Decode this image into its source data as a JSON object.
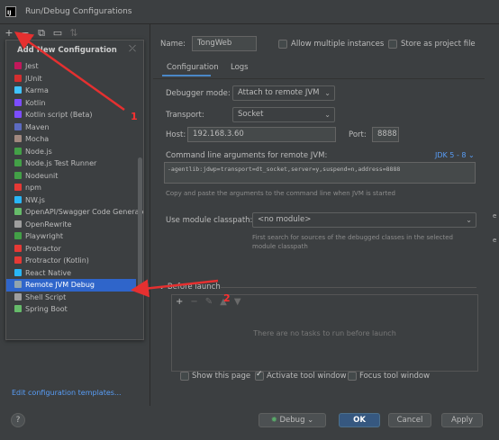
{
  "window": {
    "title": "Run/Debug Configurations",
    "app_icon_letters": "IJ"
  },
  "toolbar": {
    "icons": [
      "add-icon",
      "remove-icon",
      "copy-icon",
      "folder-icon",
      "sort-icon"
    ]
  },
  "popup": {
    "title": "Add New Configuration",
    "items": [
      {
        "label": "Jest",
        "color": "#c2185b"
      },
      {
        "label": "JUnit",
        "color": "#d32f2f"
      },
      {
        "label": "Karma",
        "color": "#40c4ff"
      },
      {
        "label": "Kotlin",
        "color": "#7c4dff"
      },
      {
        "label": "Kotlin script (Beta)",
        "color": "#7c4dff"
      },
      {
        "label": "Maven",
        "color": "#5c6bc0"
      },
      {
        "label": "Mocha",
        "color": "#a1887f"
      },
      {
        "label": "Node.js",
        "color": "#43a047"
      },
      {
        "label": "Node.js Test Runner",
        "color": "#43a047"
      },
      {
        "label": "Nodeunit",
        "color": "#43a047"
      },
      {
        "label": "npm",
        "color": "#e53935"
      },
      {
        "label": "NW.js",
        "color": "#29b6f6"
      },
      {
        "label": "OpenAPI/Swagger Code Generator",
        "color": "#66bb6a"
      },
      {
        "label": "OpenRewrite",
        "color": "#9e9e9e"
      },
      {
        "label": "Playwright",
        "color": "#43a047"
      },
      {
        "label": "Protractor",
        "color": "#e53935"
      },
      {
        "label": "Protractor (Kotlin)",
        "color": "#e53935"
      },
      {
        "label": "React Native",
        "color": "#29b6f6"
      },
      {
        "label": "Remote JVM Debug",
        "color": "#90a4ae"
      },
      {
        "label": "Shell Script",
        "color": "#9e9e9e"
      },
      {
        "label": "Spring Boot",
        "color": "#66bb6a"
      }
    ],
    "selected": "Remote JVM Debug"
  },
  "edit_templates": "Edit configuration templates...",
  "config": {
    "name_label": "Name:",
    "name_value": "TongWeb",
    "allow_multiple": "Allow multiple instances",
    "store_project": "Store as project file",
    "tabs": [
      "Configuration",
      "Logs"
    ],
    "debugger_mode_label": "Debugger mode:",
    "debugger_mode_value": "Attach to remote JVM",
    "transport_label": "Transport:",
    "transport_value": "Socket",
    "host_label": "Host:",
    "host_value": "192.168.3.60",
    "port_label": "Port:",
    "port_value": "8888",
    "cmd_label": "Command line arguments for remote JVM:",
    "jdk_selector": "JDK 5 - 8",
    "cmd_value": "-agentlib:jdwp=transport=dt_socket,server=y,suspend=n,address=8888",
    "cmd_hint": "Copy and paste the arguments to the command line when JVM is started",
    "module_label": "Use module classpath:",
    "module_value": "<no module>",
    "module_hint": "First search for sources of the debugged classes in the selected module classpath",
    "before_launch": "Before launch",
    "launch_empty": "There are no tasks to run before launch",
    "show_page": "Show this page",
    "activate_tool": "Activate tool window",
    "focus_tool": "Focus tool window"
  },
  "footer": {
    "debug": "Debug",
    "ok": "OK",
    "cancel": "Cancel",
    "apply": "Apply"
  },
  "annotations": {
    "one": "1",
    "two": "2"
  },
  "edge_text": {
    "e1": "e",
    "e2": "e"
  }
}
